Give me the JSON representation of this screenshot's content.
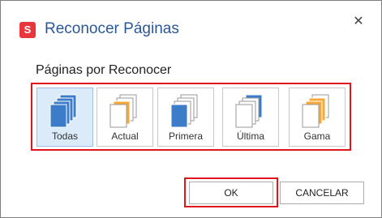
{
  "dialog": {
    "logo_letter": "S",
    "title": "Reconocer Páginas",
    "close_glyph": "✕"
  },
  "pages_section": {
    "label": "Páginas por Reconocer",
    "selected": "todas",
    "options": [
      {
        "id": "todas",
        "label": "Todas",
        "icon": "all-pages-icon"
      },
      {
        "id": "actual",
        "label": "Actual",
        "icon": "current-page-icon"
      },
      {
        "id": "primera",
        "label": "Primera",
        "icon": "first-page-icon"
      },
      {
        "id": "ultima",
        "label": "Última",
        "icon": "last-page-icon"
      },
      {
        "id": "gama",
        "label": "Gama",
        "icon": "page-range-icon"
      }
    ]
  },
  "buttons": {
    "ok": "OK",
    "cancel": "CANCELAR"
  },
  "colors": {
    "title": "#2b5797",
    "logo": "#e8363c",
    "highlight": "#e0141c",
    "page_blue": "#3d7cc9",
    "page_orange": "#f7a839",
    "selected_bg": "#dcebfa"
  }
}
